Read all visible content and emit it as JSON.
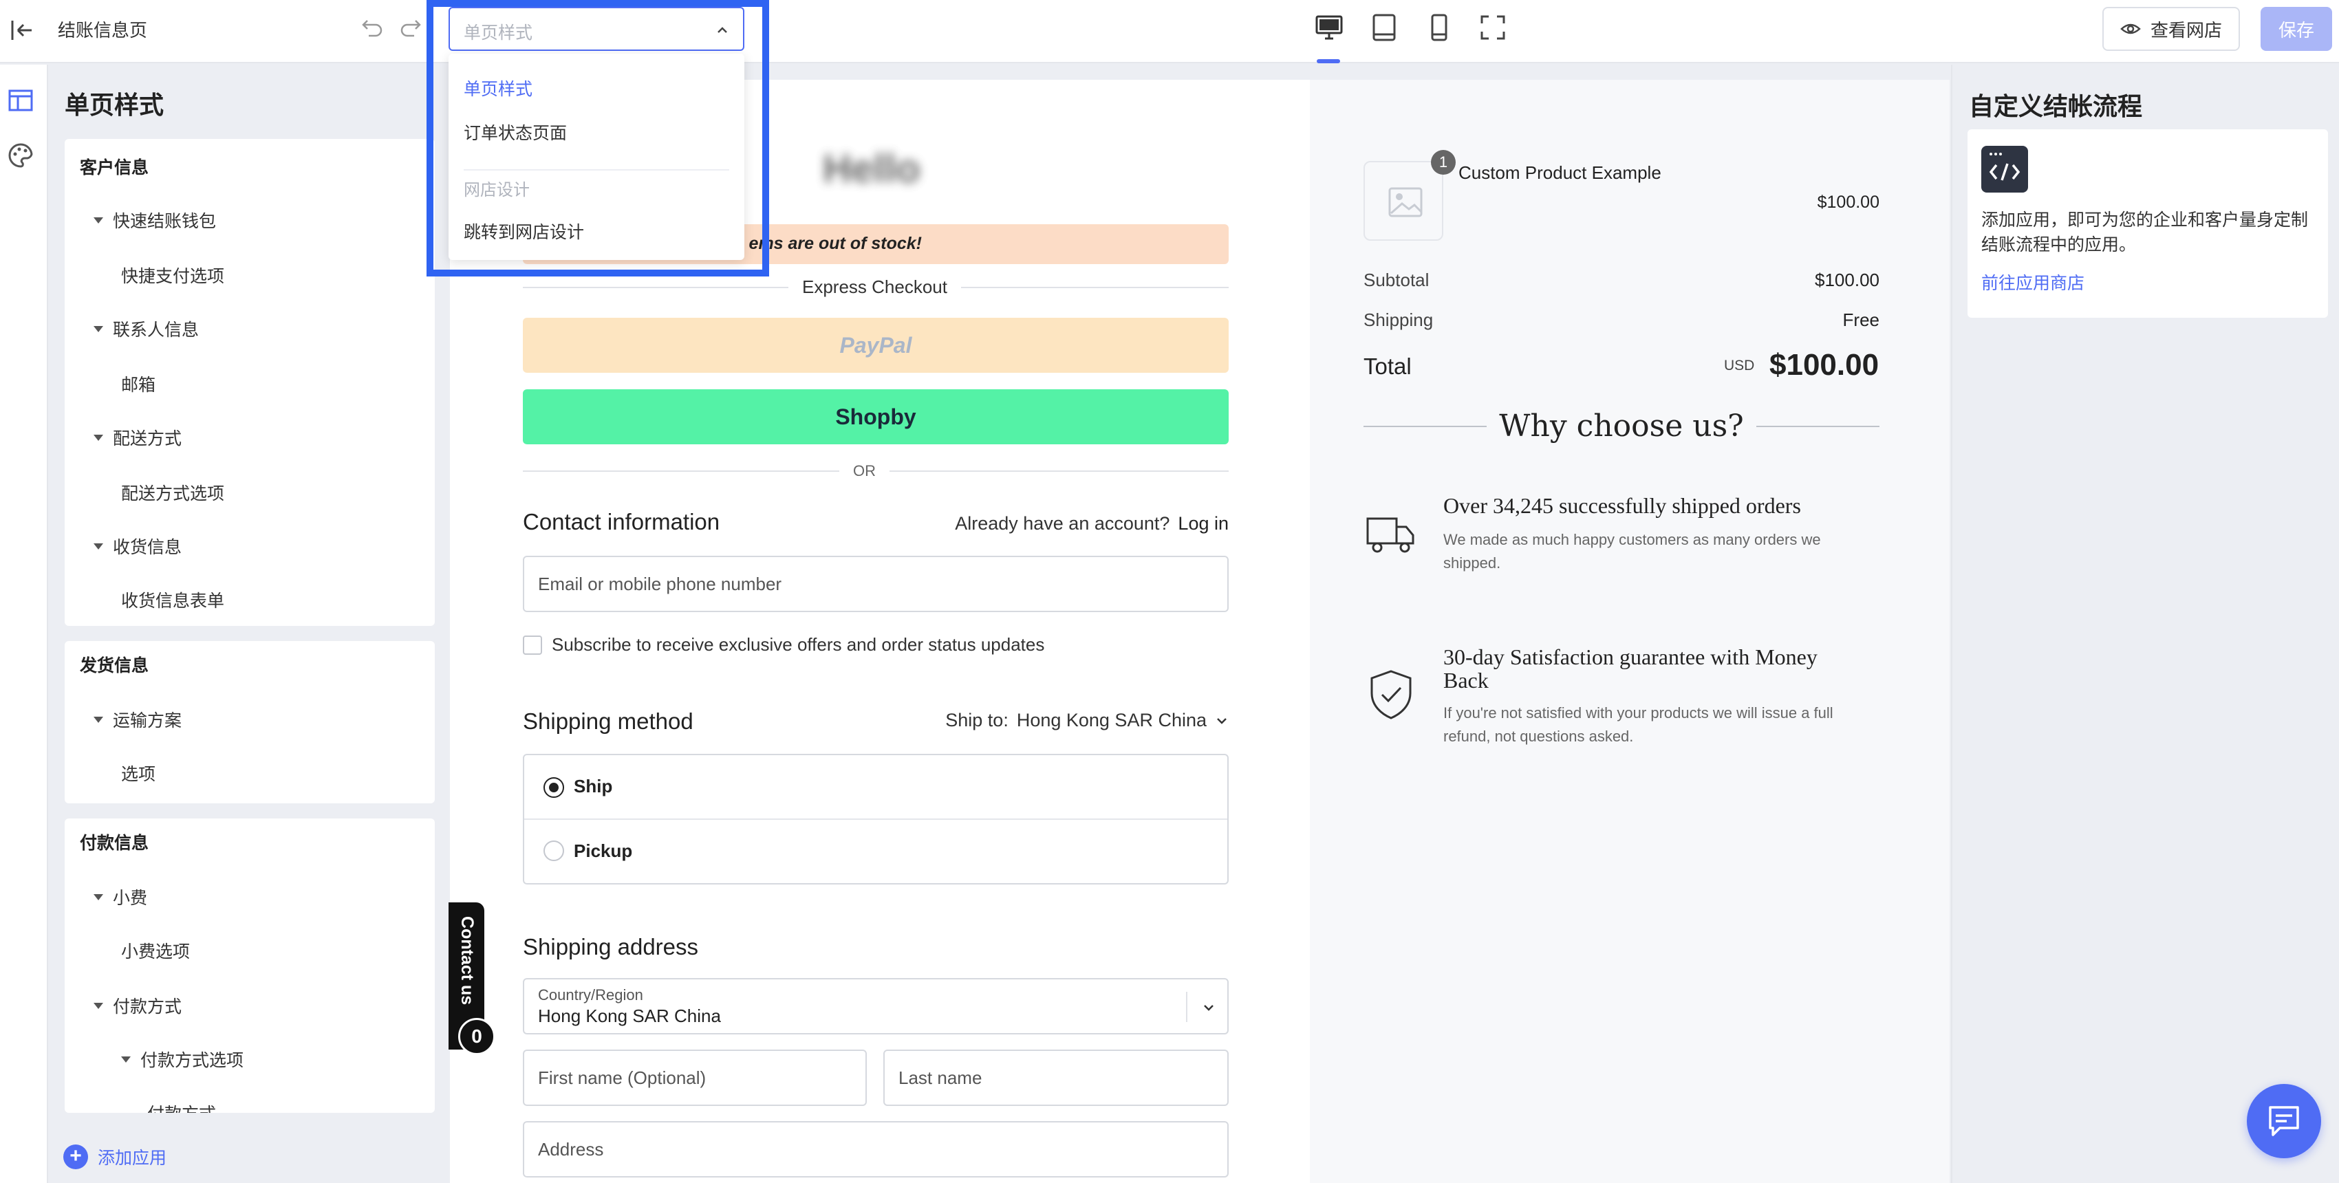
{
  "topbar": {
    "title": "结账信息页",
    "view_store": "查看网店",
    "save": "保存"
  },
  "dropdown": {
    "placeholder": "单页样式",
    "options": [
      "单页样式",
      "订单状态页面"
    ],
    "group_label": "网店设计",
    "group_option": "跳转到网店设计"
  },
  "left_panel": {
    "title": "单页样式",
    "cards": [
      {
        "head": "客户信息",
        "items": [
          {
            "label": "快速结账钱包",
            "caret": true
          },
          {
            "label": "快捷支付选项",
            "caret": false
          },
          {
            "label": "联系人信息",
            "caret": true
          },
          {
            "label": "邮箱",
            "caret": false
          },
          {
            "label": "配送方式",
            "caret": true
          },
          {
            "label": "配送方式选项",
            "caret": false
          },
          {
            "label": "收货信息",
            "caret": true
          },
          {
            "label": "收货信息表单",
            "caret": false
          }
        ]
      },
      {
        "head": "发货信息",
        "items": [
          {
            "label": "运输方案",
            "caret": true
          },
          {
            "label": "选项",
            "caret": false
          }
        ]
      },
      {
        "head": "付款信息",
        "items": [
          {
            "label": "小费",
            "caret": true
          },
          {
            "label": "小费选项",
            "caret": false
          },
          {
            "label": "付款方式",
            "caret": true
          },
          {
            "label": "付款方式选项",
            "caret": true
          },
          {
            "label": "付款方式",
            "caret": false
          }
        ]
      }
    ],
    "add_app": "添加应用"
  },
  "checkout": {
    "stock_text": "ems are out of stock!",
    "express_checkout": "Express Checkout",
    "paypal": "PayPal",
    "shopby": "Shopby",
    "or": "OR",
    "contact_title": "Contact information",
    "have_account": "Already have an account?",
    "login": "Log in",
    "email_placeholder": "Email or mobile phone number",
    "subscribe": "Subscribe to receive exclusive offers and order status updates",
    "shipping_method": "Shipping method",
    "ship_to_label": "Ship to:",
    "ship_to_value": "Hong Kong SAR China",
    "opt_ship": "Ship",
    "opt_pickup": "Pickup",
    "shipping_address": "Shipping address",
    "country_label": "Country/Region",
    "country_value": "Hong Kong SAR China",
    "first_name": "First name (Optional)",
    "last_name": "Last name",
    "address": "Address",
    "contact_us": "Contact us",
    "contact_badge": "0"
  },
  "summary": {
    "product_qty": "1",
    "product_name": "Custom Product Example",
    "product_price": "$100.00",
    "subtotal_label": "Subtotal",
    "subtotal_value": "$100.00",
    "shipping_label": "Shipping",
    "shipping_value": "Free",
    "total_label": "Total",
    "total_currency": "USD",
    "total_value": "$100.00",
    "why_title": "Why choose us?",
    "feature1_title": "Over 34,245 successfully shipped orders",
    "feature1_desc": "We made as much happy customers as many orders we shipped.",
    "feature2_title": "30-day Satisfaction guarantee with Money Back",
    "feature2_desc": "If you're not satisfied with your products we will issue a full refund, not questions asked."
  },
  "right_panel": {
    "title": "自定义结帐流程",
    "desc": "添加应用，即可为您的企业和客户量身定制结账流程中的应用。",
    "link": "前往应用商店"
  },
  "colors": {
    "accent": "#4f6cf4",
    "highlight_frame": "#2f63f2",
    "paypal_bg": "#fde5c1",
    "shopby_bg": "#54f2a6",
    "stock_banner": "#fcdcc6"
  }
}
